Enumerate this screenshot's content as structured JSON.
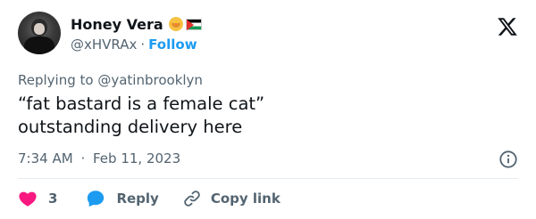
{
  "tweet": {
    "author": {
      "display_name": "Honey Vera",
      "handle": "@xHVRAx",
      "emoji_icons": [
        "honey-pot-icon",
        "palestine-flag-icon"
      ]
    },
    "follow_label": "Follow",
    "separator": "·",
    "replying_to": {
      "prefix": "Replying to",
      "mention": "@yatinbrooklyn"
    },
    "text_lines": [
      "“fat bastard is a female cat”",
      "outstanding delivery here"
    ],
    "time": "7:34 AM",
    "date": "Feb 11, 2023",
    "likes_count": "3",
    "reply_label": "Reply",
    "copy_link_label": "Copy link"
  },
  "colors": {
    "accent": "#1d9bf0",
    "like": "#f91880",
    "secondary_text": "#536471",
    "primary_text": "#0f1419",
    "divider": "#e6ecf0"
  }
}
